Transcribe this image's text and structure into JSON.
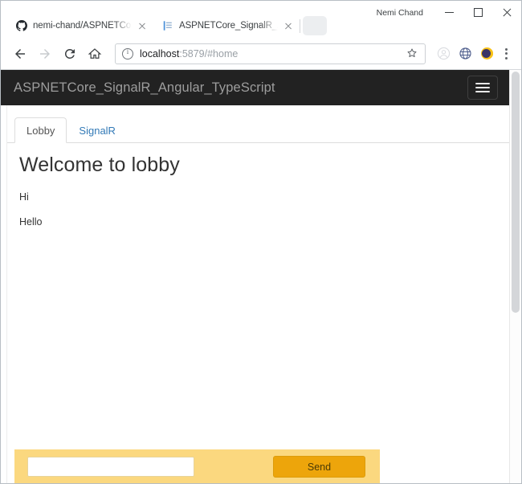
{
  "browser": {
    "profile_name": "Nemi Chand",
    "window_controls": {
      "minimize": "—",
      "maximize": "□",
      "close": "✕"
    },
    "tabs": [
      {
        "title": "nemi-chand/ASPNETCore",
        "favicon": "github-icon",
        "active": false
      },
      {
        "title": "ASPNETCore_SignalR_An",
        "favicon": "document-icon",
        "active": true
      }
    ],
    "new_tab_label": "",
    "toolbar": {
      "back_label": "Back",
      "forward_label": "Forward",
      "reload_label": "Reload",
      "home_label": "Home",
      "url_host": "localhost",
      "url_rest": ":5879/#home",
      "url_full": "localhost:5879/#home",
      "bookmark_label": "Bookmark this page",
      "extensions": [
        "profile-icon",
        "globe-icon",
        "dark-mode-moon-icon"
      ],
      "menu_label": "Customize and control Google Chrome"
    }
  },
  "app": {
    "navbar": {
      "brand": "ASPNETCore_SignalR_Angular_TypeScript",
      "toggle_label": "Toggle navigation"
    },
    "tabs": [
      {
        "label": "Lobby",
        "active": true
      },
      {
        "label": "SignalR",
        "active": false
      }
    ],
    "main": {
      "title": "Welcome to lobby",
      "messages": [
        "Hi",
        "Hello"
      ]
    },
    "chatbar": {
      "input_value": "",
      "input_placeholder": "",
      "send_label": "Send"
    }
  },
  "colors": {
    "navbar_bg": "#222222",
    "navbar_text": "#9d9d9d",
    "link": "#337ab7",
    "chatbar_bg": "#fbd87f",
    "send_btn_bg": "#eda50b"
  }
}
